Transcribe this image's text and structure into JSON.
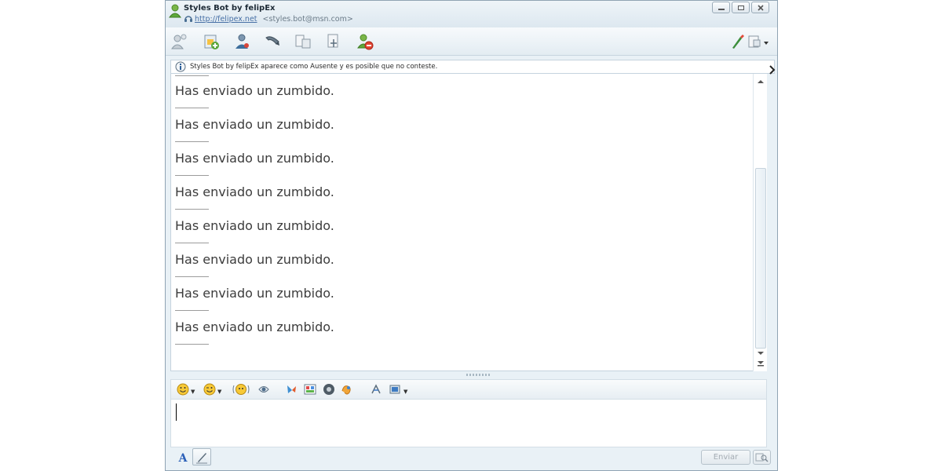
{
  "window": {
    "title": "Styles Bot by felipEx",
    "link": "http://felipex.net",
    "email": "<styles.bot@msn.com>"
  },
  "toolbar": {
    "icons": [
      "invite-icon",
      "send-files-icon",
      "video-call-icon",
      "call-icon",
      "share-folders-icon",
      "activities-icon",
      "block-icon",
      "paint-icon",
      "display-options-icon"
    ]
  },
  "infobar": {
    "text": "Styles Bot by felipEx aparece como Ausente y es posible que no conteste."
  },
  "conversation": {
    "messages": [
      "Has enviado un zumbido.",
      "Has enviado un zumbido.",
      "Has enviado un zumbido.",
      "Has enviado un zumbido.",
      "Has enviado un zumbido.",
      "Has enviado un zumbido.",
      "Has enviado un zumbido.",
      "Has enviado un zumbido."
    ]
  },
  "format_toolbar": {
    "icons": [
      "emoticon-icon",
      "wink-icon",
      "nudge-icon",
      "voice-clip-icon",
      "gift-icon",
      "background-icon",
      "game-icon",
      "handwriting-icon",
      "font-icon",
      "image-icon"
    ]
  },
  "bottom": {
    "font_label": "A",
    "send_label": "Enviar"
  },
  "colors": {
    "window_bg": "#e9f1f6",
    "accent": "#4770a6",
    "message_text": "#3c3c3c"
  }
}
